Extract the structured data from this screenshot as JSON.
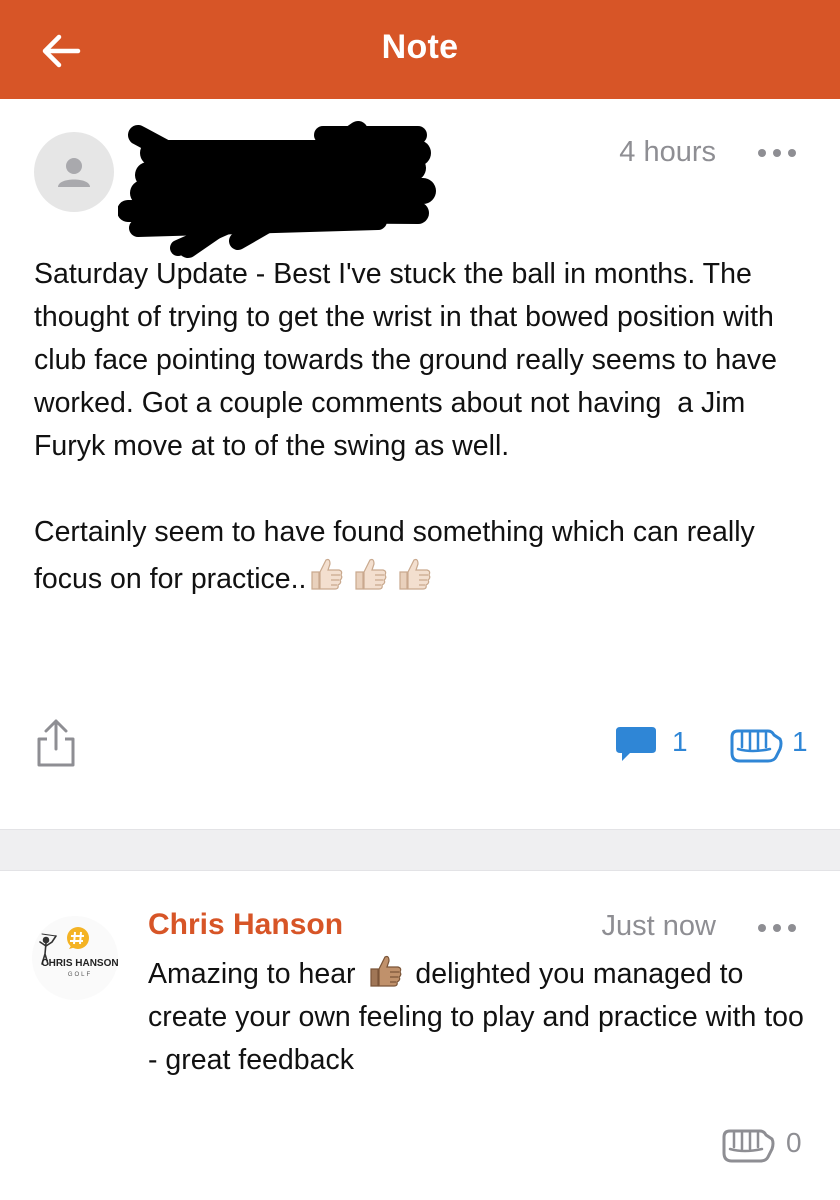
{
  "header": {
    "title": "Note",
    "back_icon": "arrow-left-icon",
    "background": "#d75527"
  },
  "post": {
    "author_name_redacted": true,
    "time": "4 hours",
    "paragraphs": [
      "Saturday Update - Best I've stuck the ball in months. The thought of trying to get the wrist in that bowed position with club face pointing towards the ground really seems to have worked. Got a couple comments about not having  a Jim Furyk move at to of the swing as well.",
      "Certainly seem to have found something which can really focus on for practice.."
    ],
    "emoji_trailing": "thumbs-up-light-skin x3",
    "comment_count": "1",
    "fist_bump_count": "1",
    "accent": "#2f86d6"
  },
  "reply": {
    "author": "Chris Hanson",
    "time": "Just now",
    "logo_text": "CHRIS HANSON",
    "logo_subtext": "GOLF",
    "text_before_emoji": "Amazing to hear ",
    "text_after_emoji": " delighted you managed to create your own feeling to play and practice with too - great feedback",
    "fist_bump_count": "0"
  }
}
